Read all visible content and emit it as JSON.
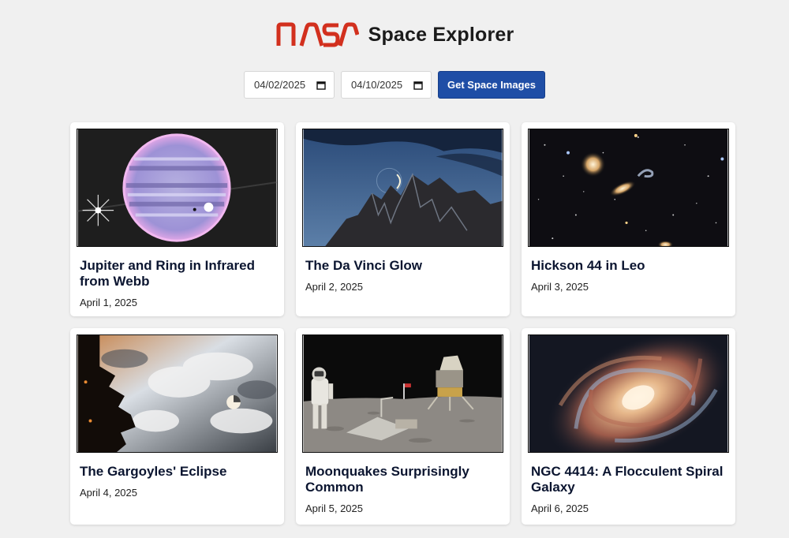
{
  "header": {
    "logo_text": "NASA",
    "title": "Space Explorer"
  },
  "controls": {
    "start_date": "04/02/2025",
    "end_date": "04/10/2025",
    "button_label": "Get Space Images"
  },
  "colors": {
    "nasa_red": "#d2301e",
    "button_blue": "#1f4ea6",
    "background": "#f0f0f0"
  },
  "cards": [
    {
      "title": "Jupiter and Ring in Infrared from Webb",
      "date": "April 1, 2025"
    },
    {
      "title": "The Da Vinci Glow",
      "date": "April 2, 2025"
    },
    {
      "title": "Hickson 44 in Leo",
      "date": "April 3, 2025"
    },
    {
      "title": "The Gargoyles' Eclipse",
      "date": "April 4, 2025"
    },
    {
      "title": "Moonquakes Surprisingly Common",
      "date": "April 5, 2025"
    },
    {
      "title": "NGC 4414: A Flocculent Spiral Galaxy",
      "date": "April 6, 2025"
    }
  ]
}
